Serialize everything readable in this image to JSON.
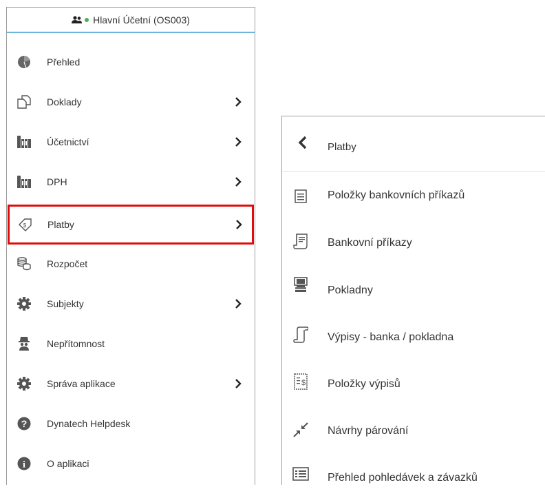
{
  "colors": {
    "accent": "#6ab6dc",
    "highlight": "#e20b0b",
    "status_online": "#4caf50",
    "icon": "#555555"
  },
  "user": {
    "name": "Hlavní Účetní (OS003)",
    "icon": "users-icon"
  },
  "menu": {
    "items": [
      {
        "label": "Přehled",
        "icon": "pie-chart-icon",
        "has_submenu": false
      },
      {
        "label": "Doklady",
        "icon": "documents-icon",
        "has_submenu": true
      },
      {
        "label": "Účetnictví",
        "icon": "ledger-books-icon",
        "has_submenu": true
      },
      {
        "label": "DPH",
        "icon": "ledger-books-icon",
        "has_submenu": true
      },
      {
        "label": "Platby",
        "icon": "payment-tag-icon",
        "has_submenu": true,
        "highlighted": true
      },
      {
        "label": "Rozpočet",
        "icon": "coins-stack-icon",
        "has_submenu": false
      },
      {
        "label": "Subjekty",
        "icon": "gear-icon",
        "has_submenu": true
      },
      {
        "label": "Nepřítomnost",
        "icon": "incognito-icon",
        "has_submenu": false
      },
      {
        "label": "Správa aplikace",
        "icon": "gear-icon",
        "has_submenu": true
      },
      {
        "label": "Dynatech Helpdesk",
        "icon": "question-circle-icon",
        "has_submenu": false
      },
      {
        "label": "O aplikaci",
        "icon": "info-circle-icon",
        "has_submenu": false
      }
    ]
  },
  "submenu": {
    "title": "Platby",
    "back_icon": "chevron-left-icon",
    "items": [
      {
        "label": "Položky bankovních příkazů",
        "icon": "list-doc-icon"
      },
      {
        "label": "Bankovní příkazy",
        "icon": "receipt-icon"
      },
      {
        "label": "Pokladny",
        "icon": "cash-register-icon"
      },
      {
        "label": "Výpisy - banka / pokladna",
        "icon": "scroll-icon"
      },
      {
        "label": "Položky výpisů",
        "icon": "statement-dollar-icon"
      },
      {
        "label": "Návrhy párování",
        "icon": "compress-arrows-icon"
      },
      {
        "label": "Přehled pohledávek a závazků",
        "icon": "list-box-icon"
      }
    ]
  }
}
